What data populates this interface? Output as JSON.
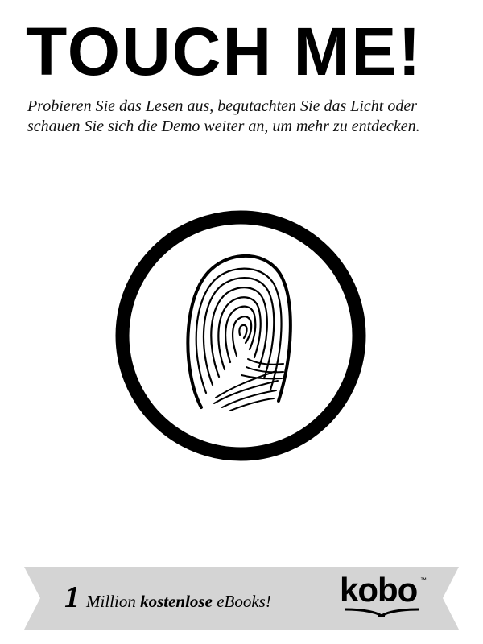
{
  "header": {
    "title": "TOUCH ME!",
    "subtitle": "Probieren Sie das Lesen aus, begutachten Sie das Licht oder schauen Sie sich die Demo weiter an, um mehr zu entdecken."
  },
  "touch_target": {
    "icon": "fingerprint-icon",
    "ring_color": "#000000"
  },
  "banner": {
    "number": "1",
    "text_pre": "Million",
    "text_bold": "kostenlose",
    "text_post": "eBooks!",
    "background": "#d4d4d4"
  },
  "brand": {
    "logo_text": "kobo",
    "trademark": "™"
  }
}
